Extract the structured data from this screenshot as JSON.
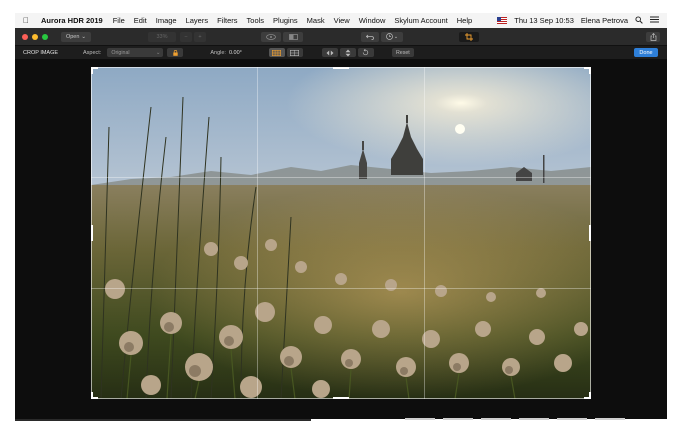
{
  "menubar": {
    "app_name": "Aurora HDR 2019",
    "items": [
      "File",
      "Edit",
      "Image",
      "Layers",
      "Filters",
      "Tools",
      "Plugins",
      "Mask",
      "View",
      "Window",
      "Skylum Account",
      "Help"
    ],
    "clock": "Thu 13 Sep  10:53",
    "user": "Elena Petrova"
  },
  "toolbar": {
    "open_label": "Open",
    "zoom_value": "33%",
    "zoom_out": "−",
    "zoom_in": "+"
  },
  "cropbar": {
    "title": "CROP IMAGE",
    "aspect_label": "Aspect:",
    "aspect_value": "Original",
    "angle_label": "Angle:",
    "angle_value": "0.00°",
    "reset_label": "Reset",
    "done_label": "Done"
  },
  "colors": {
    "accent": "#2e7fd9",
    "lock": "#f0a030",
    "crop_active": "#f0a030"
  }
}
